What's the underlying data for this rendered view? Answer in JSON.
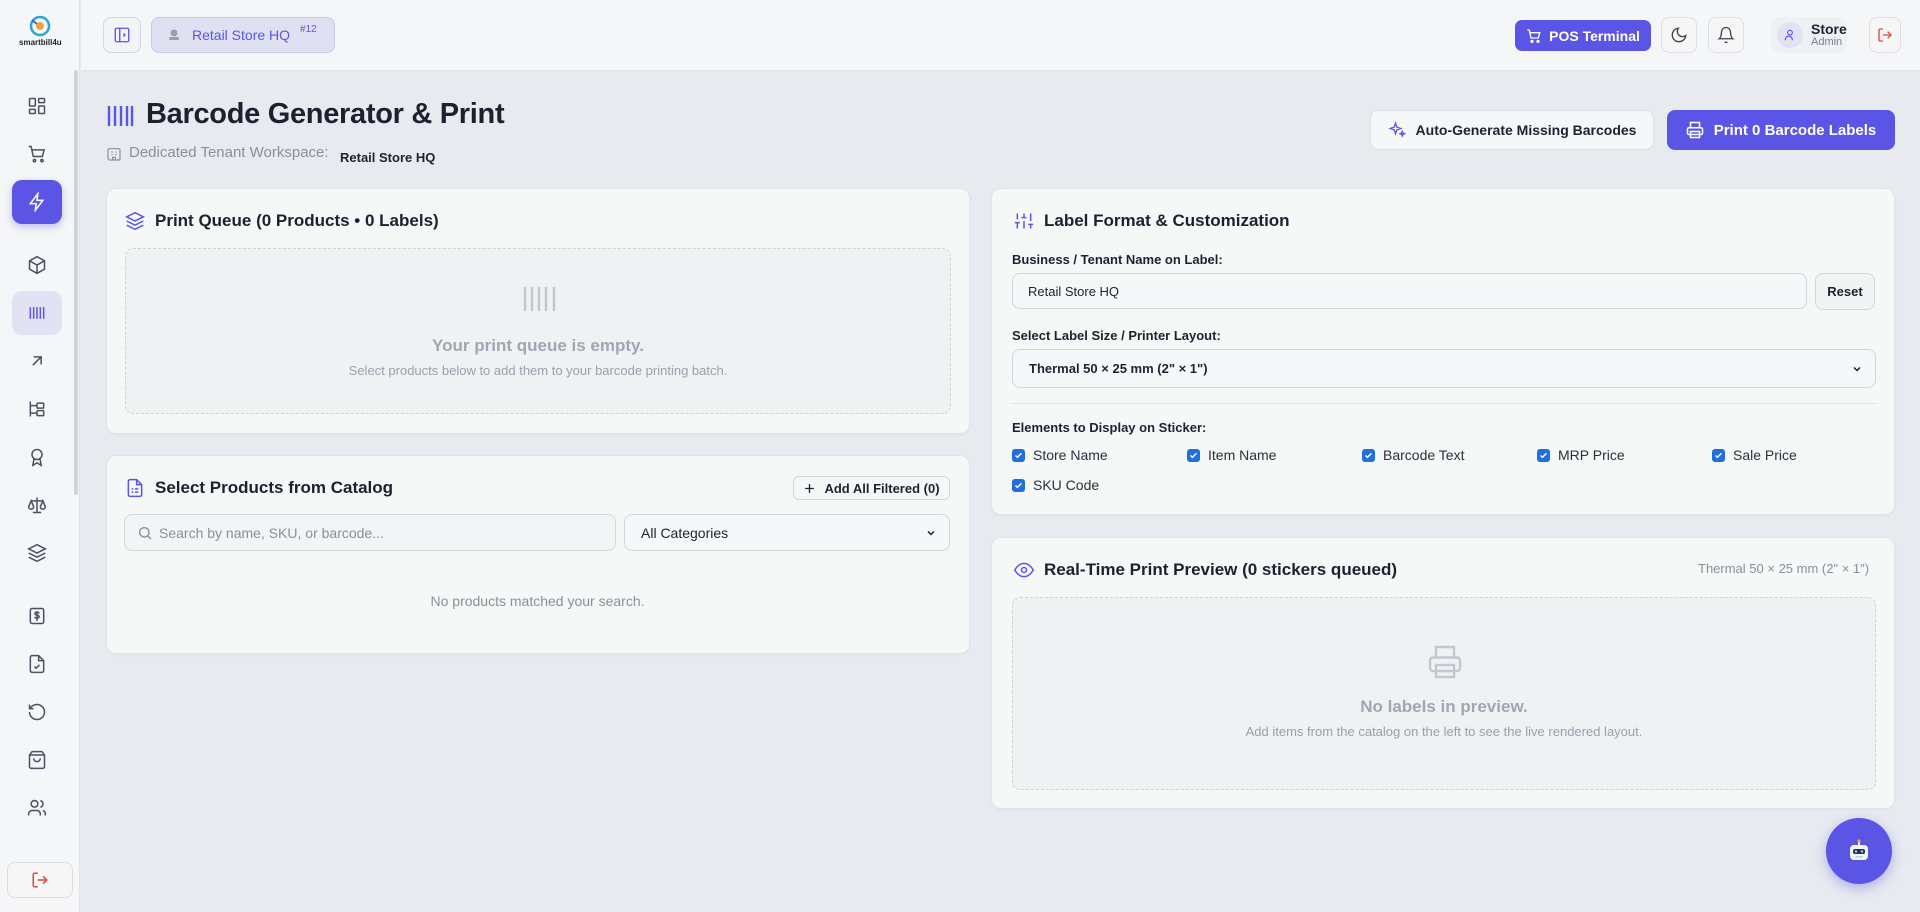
{
  "app": {
    "logo_text": "smartbill4u"
  },
  "sidebar": {
    "items": [
      {
        "name": "dashboard"
      },
      {
        "name": "cart"
      },
      {
        "name": "quick-actions"
      },
      {
        "name": "products"
      },
      {
        "name": "barcodes"
      },
      {
        "name": "reports"
      },
      {
        "name": "hierarchy"
      },
      {
        "name": "loyalty"
      },
      {
        "name": "compliance"
      },
      {
        "name": "inventory"
      },
      {
        "name": "billing"
      },
      {
        "name": "invoices"
      },
      {
        "name": "returns"
      },
      {
        "name": "purchases"
      },
      {
        "name": "customers"
      }
    ]
  },
  "topbar": {
    "tenant_name": "Retail Store HQ",
    "tenant_tag": "#12",
    "pos_label": "POS Terminal",
    "user_name": "Store",
    "user_role": "Admin"
  },
  "page": {
    "title": "Barcode Generator & Print",
    "workspace_label": "Dedicated Tenant Workspace:",
    "workspace_value": "Retail Store HQ",
    "auto_generate_label": "Auto-Generate Missing Barcodes",
    "print_label": "Print 0 Barcode Labels"
  },
  "queue": {
    "title": "Print Queue (0 Products • 0 Labels)",
    "empty_title": "Your print queue is empty.",
    "empty_sub": "Select products below to add them to your barcode printing batch."
  },
  "catalog": {
    "title": "Select Products from Catalog",
    "add_all_label": "Add All Filtered (0)",
    "search_placeholder": "Search by name, SKU, or barcode...",
    "category_selected": "All Categories",
    "no_match": "No products matched your search."
  },
  "format": {
    "title": "Label Format & Customization",
    "business_label": "Business / Tenant Name on Label:",
    "business_value": "Retail Store HQ",
    "reset_label": "Reset",
    "size_label": "Select Label Size / Printer Layout:",
    "size_selected": "Thermal 50 × 25 mm (2\" × 1\")",
    "elements_label": "Elements to Display on Sticker:",
    "elements": [
      {
        "label": "Store Name",
        "checked": true
      },
      {
        "label": "Item Name",
        "checked": true
      },
      {
        "label": "Barcode Text",
        "checked": true
      },
      {
        "label": "MRP Price",
        "checked": true
      },
      {
        "label": "Sale Price",
        "checked": true
      },
      {
        "label": "SKU Code",
        "checked": true
      }
    ]
  },
  "preview": {
    "title": "Real-Time Print Preview (0 stickers queued)",
    "size": "Thermal 50 × 25 mm (2\" × 1\")",
    "empty_title": "No labels in preview.",
    "empty_sub": "Add items from the catalog on the left to see the live rendered layout."
  },
  "colors": {
    "accent": "#5b55e6",
    "danger": "#e0453a",
    "checkbox": "#1f6fe0"
  }
}
